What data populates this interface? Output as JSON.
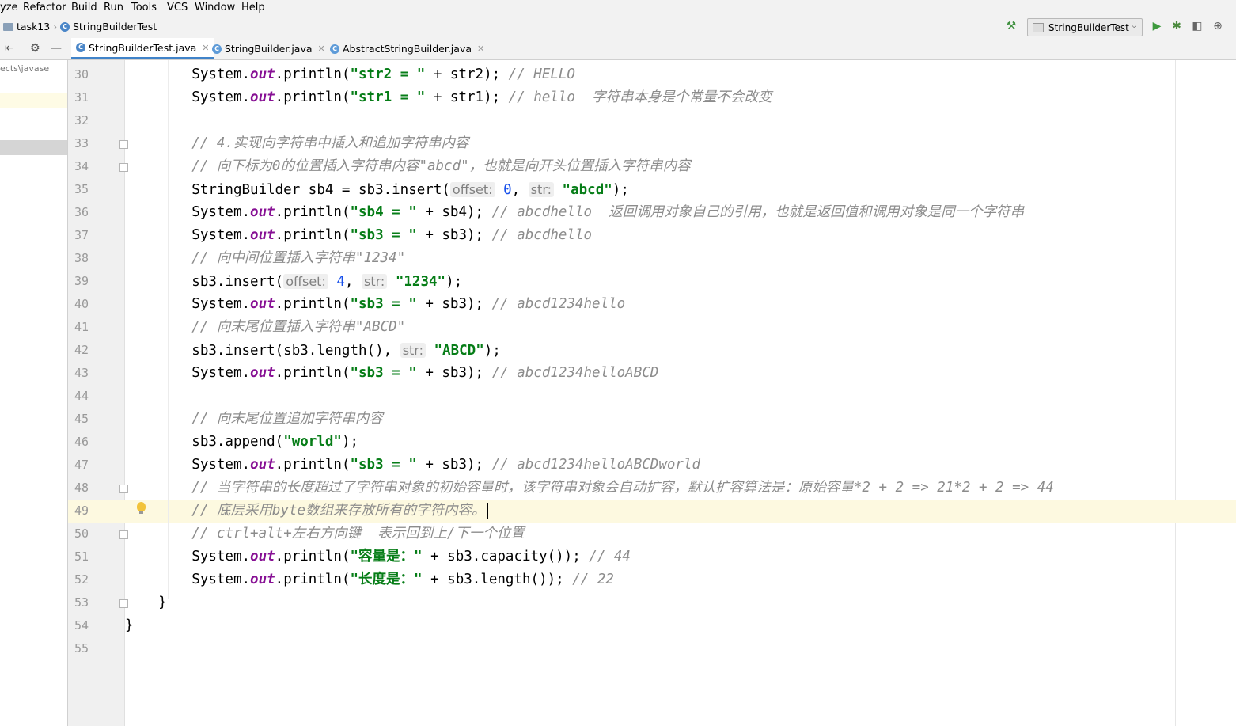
{
  "menu": [
    "yze",
    "Refactor",
    "Build",
    "Run",
    "Tools",
    "VCS",
    "Window",
    "Help"
  ],
  "breadcrumb": {
    "project": "task13",
    "file": "StringBuilderTest"
  },
  "run_config": "StringBuilderTest",
  "tabs": [
    {
      "label": "StringBuilderTest.java",
      "active": true
    },
    {
      "label": "StringBuilder.java",
      "active": false
    },
    {
      "label": "AbstractStringBuilder.java",
      "active": false
    }
  ],
  "project_panel": {
    "path": "ects\\javase"
  },
  "editor": {
    "current_line": 49,
    "lines": [
      {
        "n": "30",
        "tokens": [
          [
            "plain",
            "        System."
          ],
          [
            "fld",
            "out"
          ],
          [
            "plain",
            ".println("
          ],
          [
            "str",
            "\"str2 = \""
          ],
          [
            "plain",
            " + str2); "
          ],
          [
            "cm",
            "// HELLO"
          ]
        ]
      },
      {
        "n": "31",
        "tokens": [
          [
            "plain",
            "        System."
          ],
          [
            "fld",
            "out"
          ],
          [
            "plain",
            ".println("
          ],
          [
            "str",
            "\"str1 = \""
          ],
          [
            "plain",
            " + str1); "
          ],
          [
            "cm",
            "// hello  字符串本身是个常量不会改变"
          ]
        ]
      },
      {
        "n": "32",
        "tokens": []
      },
      {
        "n": "33",
        "tokens": [
          [
            "plain",
            "        "
          ],
          [
            "cm",
            "// 4.实现向字符串中插入和追加字符串内容"
          ]
        ]
      },
      {
        "n": "34",
        "tokens": [
          [
            "plain",
            "        "
          ],
          [
            "cm",
            "// 向下标为0的位置插入字符串内容\"abcd\"，也就是向开头位置插入字符串内容"
          ]
        ]
      },
      {
        "n": "35",
        "tokens": [
          [
            "plain",
            "        StringBuilder sb4 = sb3.insert("
          ],
          [
            "hint",
            "offset:"
          ],
          [
            "num",
            " 0"
          ],
          [
            "plain",
            ", "
          ],
          [
            "hint",
            "str:"
          ],
          [
            "str",
            " \"abcd\""
          ],
          [
            "plain",
            ");"
          ]
        ]
      },
      {
        "n": "36",
        "tokens": [
          [
            "plain",
            "        System."
          ],
          [
            "fld",
            "out"
          ],
          [
            "plain",
            ".println("
          ],
          [
            "str",
            "\"sb4 = \""
          ],
          [
            "plain",
            " + sb4); "
          ],
          [
            "cm",
            "// abcdhello  返回调用对象自己的引用，也就是返回值和调用对象是同一个字符串"
          ]
        ]
      },
      {
        "n": "37",
        "tokens": [
          [
            "plain",
            "        System."
          ],
          [
            "fld",
            "out"
          ],
          [
            "plain",
            ".println("
          ],
          [
            "str",
            "\"sb3 = \""
          ],
          [
            "plain",
            " + sb3); "
          ],
          [
            "cm",
            "// abcdhello"
          ]
        ]
      },
      {
        "n": "38",
        "tokens": [
          [
            "plain",
            "        "
          ],
          [
            "cm",
            "// 向中间位置插入字符串\"1234\""
          ]
        ]
      },
      {
        "n": "39",
        "tokens": [
          [
            "plain",
            "        sb3.insert("
          ],
          [
            "hint",
            "offset:"
          ],
          [
            "num",
            " 4"
          ],
          [
            "plain",
            ", "
          ],
          [
            "hint",
            "str:"
          ],
          [
            "str",
            " \"1234\""
          ],
          [
            "plain",
            ");"
          ]
        ]
      },
      {
        "n": "40",
        "tokens": [
          [
            "plain",
            "        System."
          ],
          [
            "fld",
            "out"
          ],
          [
            "plain",
            ".println("
          ],
          [
            "str",
            "\"sb3 = \""
          ],
          [
            "plain",
            " + sb3); "
          ],
          [
            "cm",
            "// abcd1234hello"
          ]
        ]
      },
      {
        "n": "41",
        "tokens": [
          [
            "plain",
            "        "
          ],
          [
            "cm",
            "// 向末尾位置插入字符串\"ABCD\""
          ]
        ]
      },
      {
        "n": "42",
        "tokens": [
          [
            "plain",
            "        sb3.insert(sb3.length(), "
          ],
          [
            "hint",
            "str:"
          ],
          [
            "str",
            " \"ABCD\""
          ],
          [
            "plain",
            ");"
          ]
        ]
      },
      {
        "n": "43",
        "tokens": [
          [
            "plain",
            "        System."
          ],
          [
            "fld",
            "out"
          ],
          [
            "plain",
            ".println("
          ],
          [
            "str",
            "\"sb3 = \""
          ],
          [
            "plain",
            " + sb3); "
          ],
          [
            "cm",
            "// abcd1234helloABCD"
          ]
        ]
      },
      {
        "n": "44",
        "tokens": []
      },
      {
        "n": "45",
        "tokens": [
          [
            "plain",
            "        "
          ],
          [
            "cm",
            "// 向末尾位置追加字符串内容"
          ]
        ]
      },
      {
        "n": "46",
        "tokens": [
          [
            "plain",
            "        sb3.append("
          ],
          [
            "str",
            "\"world\""
          ],
          [
            "plain",
            ");"
          ]
        ]
      },
      {
        "n": "47",
        "tokens": [
          [
            "plain",
            "        System."
          ],
          [
            "fld",
            "out"
          ],
          [
            "plain",
            ".println("
          ],
          [
            "str",
            "\"sb3 = \""
          ],
          [
            "plain",
            " + sb3); "
          ],
          [
            "cm",
            "// abcd1234helloABCDworld"
          ]
        ]
      },
      {
        "n": "48",
        "tokens": [
          [
            "plain",
            "        "
          ],
          [
            "cm",
            "// 当字符串的长度超过了字符串对象的初始容量时，该字符串对象会自动扩容，默认扩容算法是：原始容量*2 + 2 => 21*2 + 2 => 44"
          ]
        ]
      },
      {
        "n": "49",
        "tokens": [
          [
            "plain",
            "        "
          ],
          [
            "cm",
            "// 底层采用byte数组来存放所有的字符内容。"
          ],
          [
            "caret",
            ""
          ]
        ]
      },
      {
        "n": "50",
        "tokens": [
          [
            "plain",
            "        "
          ],
          [
            "cm",
            "// ctrl+alt+左右方向键  表示回到上/下一个位置"
          ]
        ]
      },
      {
        "n": "51",
        "tokens": [
          [
            "plain",
            "        System."
          ],
          [
            "fld",
            "out"
          ],
          [
            "plain",
            ".println("
          ],
          [
            "str",
            "\"容量是：\""
          ],
          [
            "plain",
            " + sb3.capacity()); "
          ],
          [
            "cm",
            "// 44"
          ]
        ]
      },
      {
        "n": "52",
        "tokens": [
          [
            "plain",
            "        System."
          ],
          [
            "fld",
            "out"
          ],
          [
            "plain",
            ".println("
          ],
          [
            "str",
            "\"长度是：\""
          ],
          [
            "plain",
            " + sb3.length()); "
          ],
          [
            "cm",
            "// 22"
          ]
        ]
      },
      {
        "n": "53",
        "tokens": [
          [
            "plain",
            "    }"
          ]
        ]
      },
      {
        "n": "54",
        "tokens": [
          [
            "plain",
            "}"
          ]
        ]
      },
      {
        "n": "55",
        "tokens": []
      }
    ]
  }
}
